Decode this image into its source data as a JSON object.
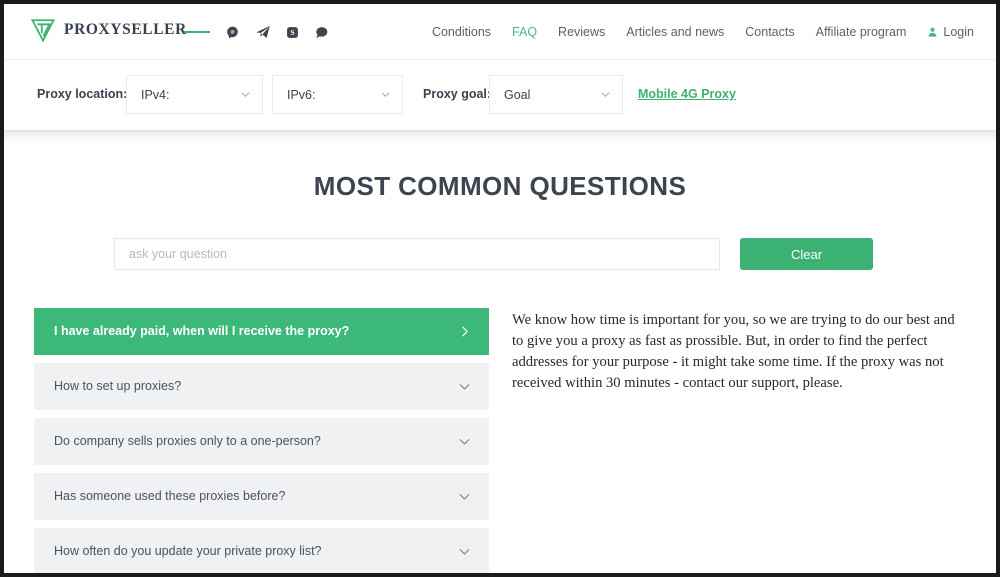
{
  "header": {
    "brand_name": "PROXYSELLER",
    "logo_icon": "proxyseller-triangle-logo",
    "social": [
      {
        "name": "dash-separator",
        "icon": "dash-icon"
      },
      {
        "name": "chat-bubble",
        "icon": "chat-bubble-icon"
      },
      {
        "name": "telegram",
        "icon": "telegram-plane-icon"
      },
      {
        "name": "skype",
        "icon": "skype-icon"
      },
      {
        "name": "messages",
        "icon": "message-bubble-icon"
      }
    ],
    "nav": [
      {
        "label": "Conditions",
        "active": false
      },
      {
        "label": "FAQ",
        "active": true
      },
      {
        "label": "Reviews",
        "active": false
      },
      {
        "label": "Articles and news",
        "active": false
      },
      {
        "label": "Contacts",
        "active": false
      },
      {
        "label": "Affiliate program",
        "active": false
      }
    ],
    "login": {
      "label": "Login",
      "icon": "user-icon"
    }
  },
  "filter_bar": {
    "location_label": "Proxy location:",
    "ipv4_select": {
      "value": "IPv4:",
      "icon": "chevron-down-icon"
    },
    "ipv6_select": {
      "value": "IPv6:",
      "icon": "chevron-down-icon"
    },
    "goal_label": "Proxy goal:",
    "goal_select": {
      "value": "Goal",
      "icon": "chevron-down-icon"
    },
    "mobile_link": "Mobile 4G Proxy"
  },
  "main": {
    "title": "MOST COMMON QUESTIONS",
    "search": {
      "value": "",
      "placeholder": "ask your question"
    },
    "clear_button": "Clear",
    "faq_items": [
      {
        "question": "I have already paid, when will I receive the proxy?",
        "active": true,
        "icon": "chevron-right-icon"
      },
      {
        "question": "How to set up proxies?",
        "active": false,
        "icon": "chevron-down-icon"
      },
      {
        "question": "Do company sells proxies only to a one-person?",
        "active": false,
        "icon": "chevron-down-icon"
      },
      {
        "question": "Has someone used these proxies before?",
        "active": false,
        "icon": "chevron-down-icon"
      },
      {
        "question": "How often do you update your private proxy list?",
        "active": false,
        "icon": "chevron-down-icon"
      }
    ],
    "answer": "We know how time is important for you, so we are trying to do our best and to give you a proxy as fast as prossible. But, in order to find the perfect addresses for your purpose - it might take some time. If the proxy was not received within 30 minutes - contact our support, please."
  },
  "colors": {
    "brand_green": "#3bb273",
    "active_green": "#3cb878",
    "text_dark": "#3a4250",
    "row_gray": "#f0f1f2"
  }
}
